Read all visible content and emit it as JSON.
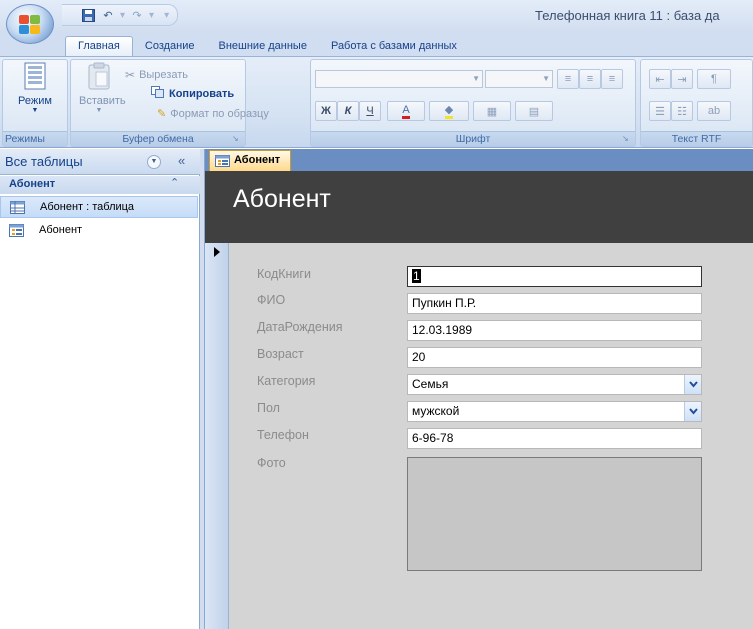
{
  "window": {
    "title": "Телефонная книга 11 : база да"
  },
  "ribbon_tabs": [
    {
      "label": "Главная"
    },
    {
      "label": "Создание"
    },
    {
      "label": "Внешние данные"
    },
    {
      "label": "Работа с базами данных"
    }
  ],
  "ribbon": {
    "views": {
      "mode_label": "Режим",
      "group_label": "Режимы"
    },
    "clipboard": {
      "paste_label": "Вставить",
      "cut_label": "Вырезать",
      "copy_label": "Копировать",
      "format_painter_label": "Формат по образцу",
      "group_label": "Буфер обмена"
    },
    "font": {
      "group_label": "Шрифт",
      "bold": "Ж",
      "italic": "К",
      "underline": "Ч",
      "font_color": "A"
    },
    "rtf": {
      "group_label": "Текст RTF"
    }
  },
  "nav": {
    "header": "Все таблицы",
    "group": "Абонент",
    "items": [
      {
        "label": "Абонент : таблица",
        "type": "table"
      },
      {
        "label": "Абонент",
        "type": "form"
      }
    ]
  },
  "document": {
    "tab_label": "Абонент",
    "form_title": "Абонент",
    "fields": [
      {
        "label": "КодКниги",
        "value": "1"
      },
      {
        "label": "ФИО",
        "value": "Пупкин П.Р."
      },
      {
        "label": "ДатаРождения",
        "value": "12.03.1989"
      },
      {
        "label": "Возраст",
        "value": "20"
      },
      {
        "label": "Категория",
        "value": "Семья"
      },
      {
        "label": "Пол",
        "value": "мужской"
      },
      {
        "label": "Телефон",
        "value": "6-96-78"
      },
      {
        "label": "Фото",
        "value": ""
      }
    ]
  },
  "colors": {
    "form_header_bg": "#404040",
    "form_body_bg": "#d4d4d4",
    "doc_tab_bg": "#ffd98a",
    "label_color": "#8b8b8b"
  }
}
